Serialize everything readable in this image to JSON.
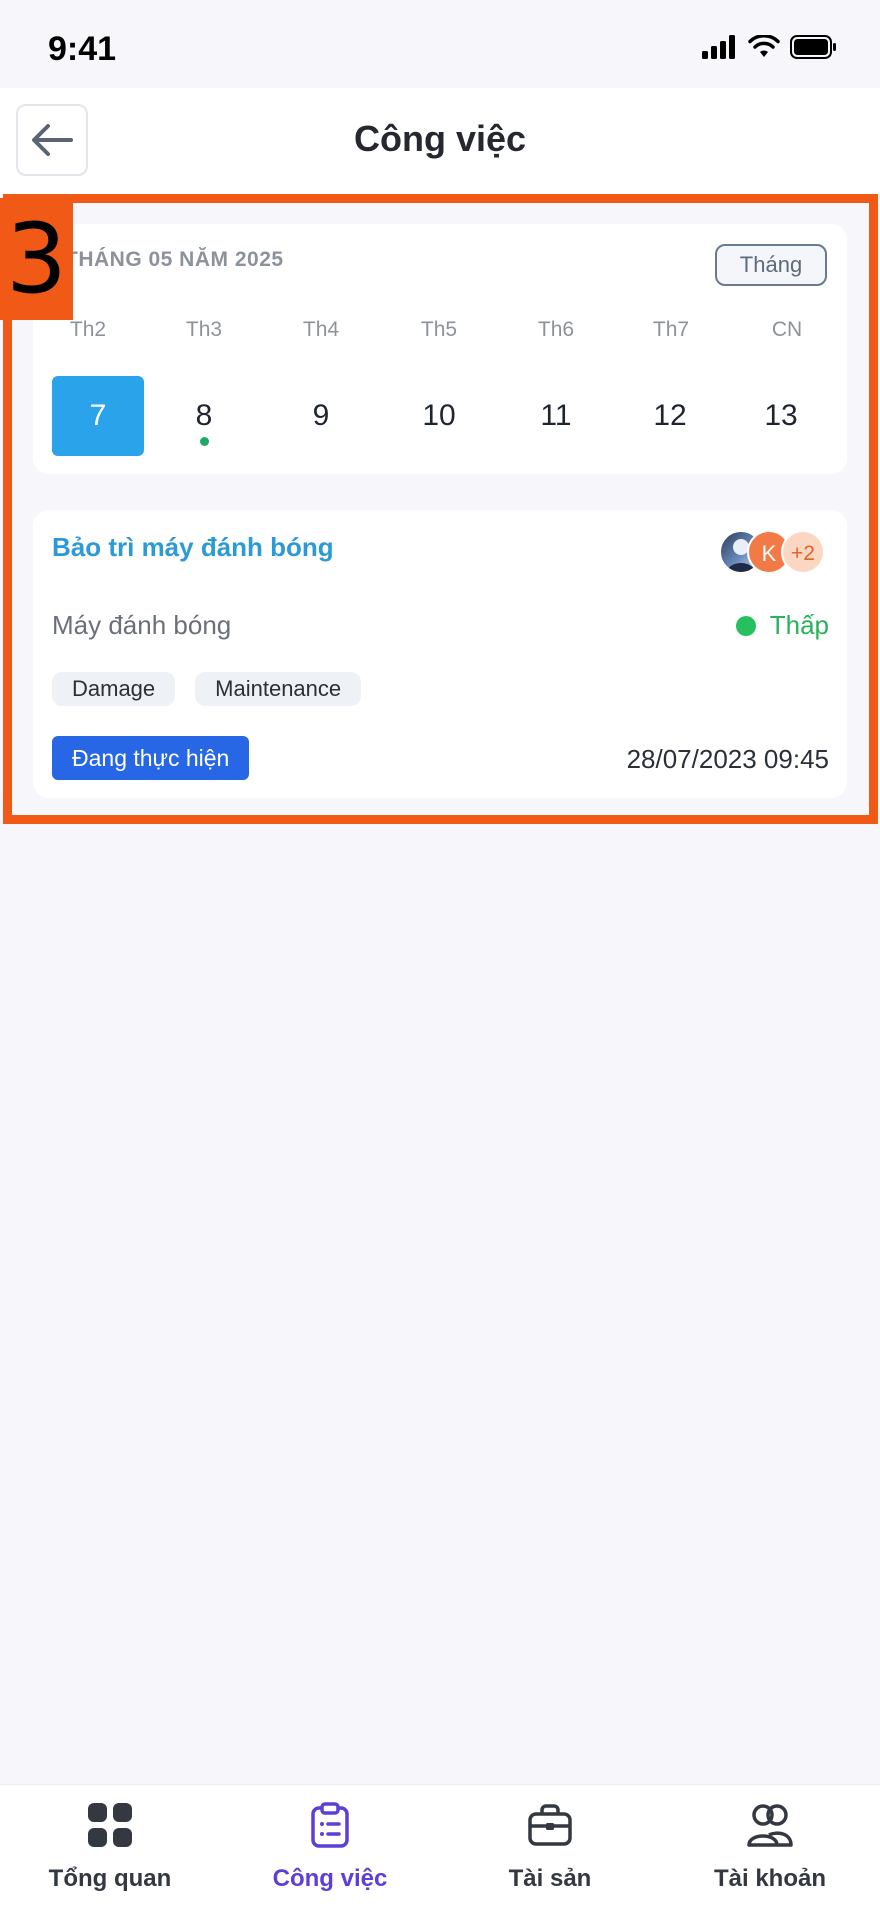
{
  "status_bar": {
    "time": "9:41"
  },
  "header": {
    "title": "Công việc"
  },
  "highlight": {
    "badge": "3"
  },
  "calendar": {
    "month_label": "THÁNG 05 NĂM 2025",
    "view_toggle": "Tháng",
    "weekdays": [
      "Th2",
      "Th3",
      "Th4",
      "Th5",
      "Th6",
      "Th7",
      "CN"
    ],
    "dates": [
      "7",
      "8",
      "9",
      "10",
      "11",
      "12",
      "13"
    ],
    "selected_date": "7",
    "dates_with_events": [
      "8"
    ]
  },
  "task": {
    "title": "Bảo trì máy đánh bóng",
    "asset": "Máy đánh bóng",
    "priority": "Thấp",
    "tags": [
      "Damage",
      "Maintenance"
    ],
    "status": "Đang thực hiện",
    "datetime": "28/07/2023 09:45",
    "assignees": {
      "initial": "K",
      "more": "+2"
    }
  },
  "bottom_nav": {
    "items": [
      {
        "label": "Tổng quan",
        "icon": "grid-icon"
      },
      {
        "label": "Công việc",
        "icon": "clipboard-icon"
      },
      {
        "label": "Tài sản",
        "icon": "briefcase-icon"
      },
      {
        "label": "Tài khoản",
        "icon": "users-icon"
      }
    ],
    "active": "Công việc"
  },
  "colors": {
    "accent": "#2aa3ea",
    "highlight": "#f05a16",
    "nav_active": "#5b3fd6",
    "status_pill": "#2767e6",
    "priority_low": "#27c05f"
  }
}
